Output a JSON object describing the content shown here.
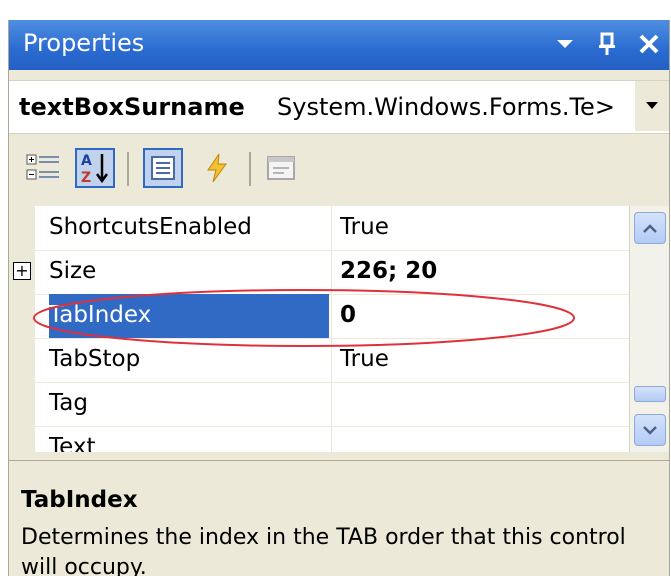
{
  "titlebar": {
    "title": "Properties",
    "icons": [
      "dropdown-arrow-icon",
      "pin-icon",
      "close-icon"
    ]
  },
  "object_selector": {
    "name": "textBoxSurname",
    "type": "System.Windows.Forms.Te>"
  },
  "toolbar": {
    "buttons": [
      "categorized-icon",
      "alphabetical-icon",
      "properties-icon",
      "events-icon",
      "property-pages-icon"
    ]
  },
  "grid": {
    "rows": [
      {
        "name": "ShortcutsEnabled",
        "value": "True"
      },
      {
        "name": "Size",
        "value": "226; 20"
      },
      {
        "name": "TabIndex",
        "value": "0"
      },
      {
        "name": "TabStop",
        "value": "True"
      },
      {
        "name": "Tag",
        "value": ""
      },
      {
        "name": "Text",
        "value": ""
      }
    ],
    "expander_symbol": "+"
  },
  "description": {
    "title": "TabIndex",
    "text": "Determines the index in the TAB order that this control will occupy."
  },
  "colors": {
    "title_bar": "#2a6bd1",
    "selection": "#316ac5",
    "annotation": "#e0303a"
  }
}
